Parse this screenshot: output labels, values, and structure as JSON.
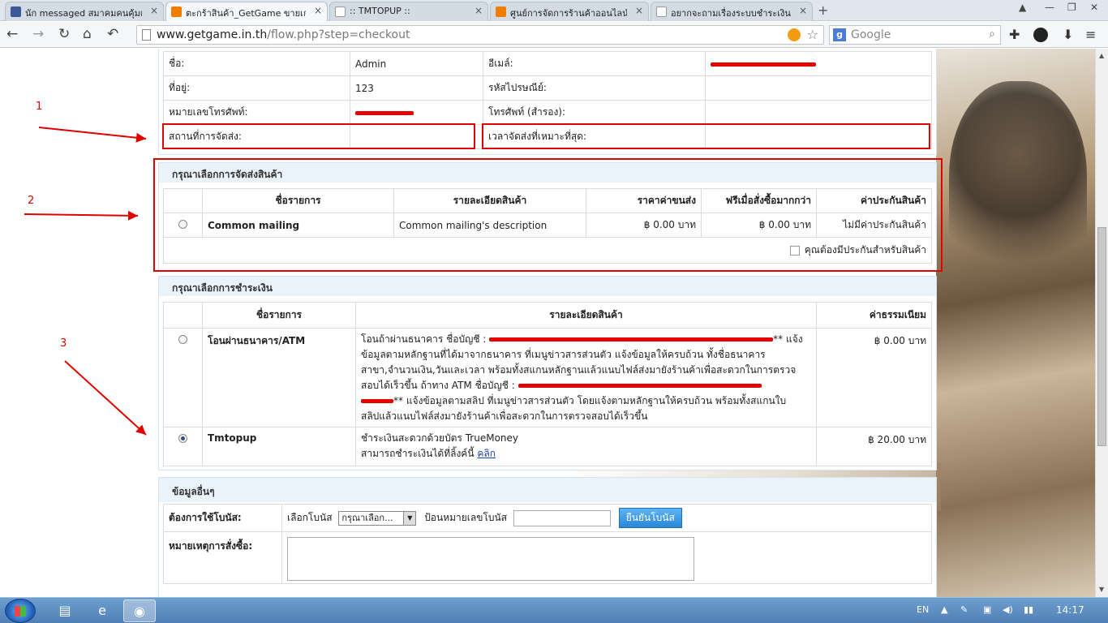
{
  "browser": {
    "tabs": [
      {
        "label": "นัก messaged สมาคมคนคุ้มเว็บ",
        "color": "#3b5998",
        "close": "×"
      },
      {
        "label": "ตะกร้าสินค้า_GetGame ขายเกม",
        "color": "#f07d00",
        "close": "×",
        "active": true
      },
      {
        "label": ":: TMTOPUP ::",
        "color": "#ffffff",
        "close": "×"
      },
      {
        "label": "ศูนย์การจัดการร้านค้าออนไลน์ E",
        "color": "#f07d00",
        "close": "×"
      },
      {
        "label": "อยากจะถามเรื่องระบบชำระเงิน ก",
        "color": "#ffffff",
        "close": "×"
      }
    ],
    "new_tab": "+",
    "url_host": "www.getgame.in.th",
    "url_path": "/flow.php?step=checkout",
    "search_placeholder": "Google",
    "search_logo": "g"
  },
  "annotations": {
    "n1": "1",
    "n2": "2",
    "n3": "3"
  },
  "consignee": {
    "name_label": "ชื่อ:",
    "name_value": "Admin",
    "email_label": "อีเมล์:",
    "address_label": "ที่อยู่:",
    "address_value": "123",
    "zip_label": "รหัสไปรษณีย์:",
    "phone_label": "หมายเลขโทรศัพท์:",
    "phone2_label": "โทรศัพท์ (สำรอง):",
    "delivery_place_label": "สถานที่การจัดส่ง:",
    "delivery_time_label": "เวลาจัดส่งที่เหมาะที่สุด:"
  },
  "shipping": {
    "title": "กรุณาเลือกการจัดส่งสินค้า",
    "headers": [
      "ชื่อรายการ",
      "รายละเอียดสินค้า",
      "ราคาค่าขนส่ง",
      "ฟรีเมื่อสั่งซื้อมากกว่า",
      "ค่าประกันสินค้า"
    ],
    "row": {
      "name": "Common mailing",
      "desc": "Common mailing's description",
      "price": "฿ 0.00 บาท",
      "free_over": "฿ 0.00 บาท",
      "insure": "ไม่มีค่าประกันสินค้า"
    },
    "insure_check_label": "คุณต้องมีประกันสำหรับสินค้า"
  },
  "payment": {
    "title": "กรุณาเลือกการชำระเงิน",
    "headers": [
      "ชื่อรายการ",
      "รายละเอียดสินค้า",
      "ค่าธรรมเนียม"
    ],
    "bank": {
      "name": "โอนผ่านธนาคาร/ATM",
      "l1_a": "โอนถ้าผ่านธนาคาร ชื่อบัญชี :",
      "l1_b": "** แจ้ง",
      "l2": "ข้อมูลตามหลักฐานที่ได้มาจากธนาคาร ที่เมนูข่าวสารส่วนตัว แจ้งข้อมูลให้ครบถ้วน ทั้งชื่อธนาคาร",
      "l3": "สาขา,จำนวนเงิน,วันและเวลา พร้อมทั้งสแกนหลักฐานแล้วแนบไฟล์ส่งมายังร้านค้าเพื่อสะดวกในการตรวจ",
      "l4": "สอบได้เร็วขึ้น ถ้าทาง ATM ชื่อบัญชี :",
      "l5": "** แจ้งข้อมูลตามสลิป ที่เมนูข่าวสารส่วนตัว โดยแจ้งตามหลักฐานให้ครบถ้วน พร้อมทั้งสแกนใบ",
      "l6": "สลิปแล้วแนบไฟล์ส่งมายังร้านค้าเพื่อสะดวกในการตรวจสอบได้เร็วขึ้น",
      "fee": "฿ 0.00 บาท"
    },
    "tmtopup": {
      "name": "Tmtopup",
      "l1": "ชำระเงินสะดวกด้วยบัตร TrueMoney",
      "l2": "สามารถชำระเงินได้ที่ลิ้งค์นี้",
      "link": "คลิก",
      "fee": "฿ 20.00 บาท"
    }
  },
  "other": {
    "title": "ข้อมูลอื่นๆ",
    "bonus_label": "ต้องการใช้โบนัส:",
    "select_bonus_label": "เลือกโบนัส",
    "select_value": "กรุณาเลือก...",
    "enter_bonus_label": "ป้อนหมายเลขโบนัส",
    "confirm_button": "ยืนยันโบนัส",
    "note_label": "หมายเหตุการสั่งซื้อ:"
  },
  "taskbar": {
    "lang": "EN",
    "time": "14:17"
  }
}
